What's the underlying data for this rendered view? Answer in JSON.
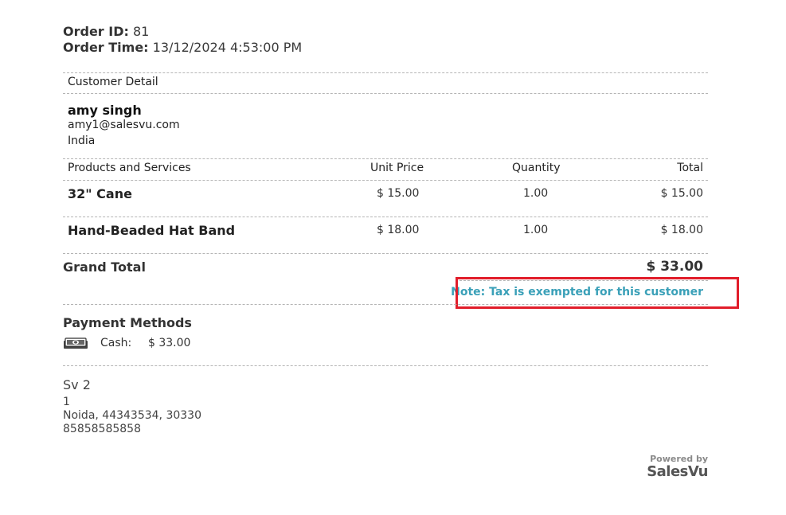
{
  "order": {
    "id_label": "Order ID:",
    "id_value": "81",
    "time_label": "Order Time:",
    "time_value": "13/12/2024 4:53:00 PM"
  },
  "customer": {
    "heading": "Customer Detail",
    "name": "amy singh",
    "email": "amy1@salesvu.com",
    "country": "India"
  },
  "products": {
    "headers": [
      "Products and Services",
      "Unit Price",
      "Quantity",
      "Total"
    ],
    "rows": [
      {
        "name": "32\" Cane",
        "unit_price": "$ 15.00",
        "quantity": "1.00",
        "total": "$ 15.00"
      },
      {
        "name": "Hand-Beaded Hat Band",
        "unit_price": "$ 18.00",
        "quantity": "1.00",
        "total": "$ 18.00"
      }
    ]
  },
  "totals": {
    "grand_label": "Grand Total",
    "grand_value": "$ 33.00",
    "note": "Note: Tax is exempted for this customer"
  },
  "payment": {
    "title": "Payment Methods",
    "method": "Cash:",
    "amount": "$ 33.00",
    "icon": "cash-icon"
  },
  "store": {
    "name": "Sv 2",
    "line1": "1",
    "line2": "Noida, 44343534, 30330",
    "phone": "85858585858"
  },
  "branding": {
    "powered": "Powered by",
    "brand": "SalesVu"
  },
  "colors": {
    "highlight": "#e11d2a",
    "note": "#3aa0b8"
  }
}
